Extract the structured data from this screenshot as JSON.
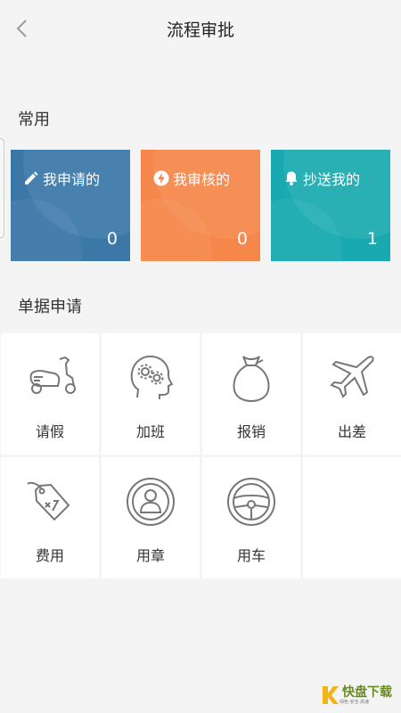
{
  "header": {
    "title": "流程审批"
  },
  "common": {
    "title": "常用",
    "cards": [
      {
        "label": "我申请的",
        "count": "0",
        "icon": "pencil-icon",
        "color": "#3b78a8"
      },
      {
        "label": "我审核的",
        "count": "0",
        "icon": "lightning-icon",
        "color": "#f6874a"
      },
      {
        "label": "抄送我的",
        "count": "1",
        "icon": "bell-icon",
        "color": "#18aab0"
      }
    ]
  },
  "forms": {
    "title": "单据申请",
    "items": [
      {
        "label": "请假",
        "icon": "scooter-icon"
      },
      {
        "label": "加班",
        "icon": "head-gears-icon"
      },
      {
        "label": "报销",
        "icon": "money-bag-icon"
      },
      {
        "label": "出差",
        "icon": "airplane-icon"
      },
      {
        "label": "费用",
        "icon": "price-tag-icon"
      },
      {
        "label": "用章",
        "icon": "stamp-icon"
      },
      {
        "label": "用车",
        "icon": "steering-wheel-icon"
      }
    ]
  },
  "watermark": {
    "text": "快盘下载",
    "sub": "绿色·安全·高速"
  }
}
